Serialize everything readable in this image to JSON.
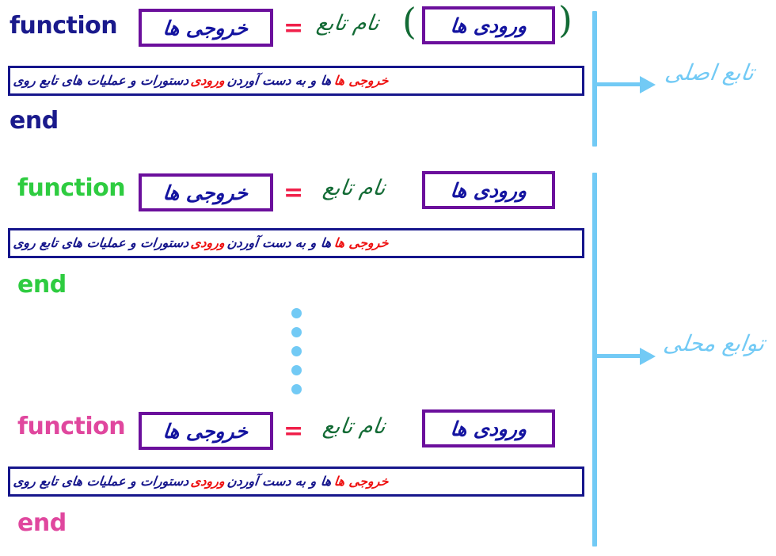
{
  "colors": {
    "main_function_keyword": "#1a1a8c",
    "local_function_keyword_1": "#2ecc40",
    "local_function_keyword_2": "#e0479e",
    "box_border_purple": "#6b0f9c",
    "inner_text_blue": "#1414a0",
    "equals_red": "#f0204a",
    "function_name_green": "#136b35",
    "body_border_navy": "#16168c",
    "highlight_red": "#ee1111",
    "annotation_blue": "#72caf5"
  },
  "keywords": {
    "function": "function",
    "end": "end",
    "equals": "=",
    "paren_open": ")",
    "paren_close": "("
  },
  "labels": {
    "outputs": "خروجی ها",
    "inputs": "ورودی ها",
    "function_name": "نام تابع"
  },
  "body_text": {
    "part1": "دستورات و عملیات های تابع روی",
    "part2_red": "ورودی",
    "part3": "ها و به دست آوردن",
    "part4_red": "خروجی ها"
  },
  "annotations": {
    "main_function": "تابع اصلی",
    "local_functions": "توابع محلی"
  },
  "blocks": [
    {
      "id": "main-function",
      "keyword_color": "#1a1a8c",
      "has_parentheses": true
    },
    {
      "id": "local-function-first",
      "keyword_color": "#2ecc40",
      "has_parentheses": false
    },
    {
      "id": "local-function-last",
      "keyword_color": "#e0479e",
      "has_parentheses": false
    }
  ],
  "ellipsis": {
    "dot_count": 5
  }
}
